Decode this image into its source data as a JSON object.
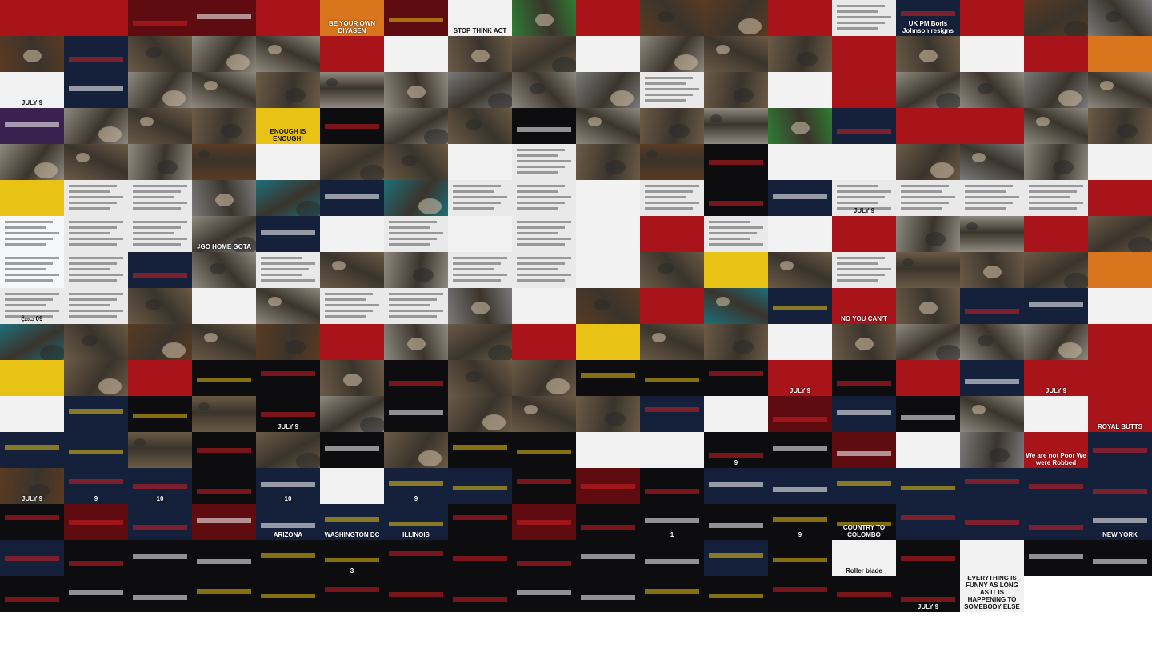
{
  "grid": {
    "cols": 18,
    "rows": 17,
    "tile_count": 302
  },
  "palette": {
    "red": "#a8141a",
    "darkred": "#5e0c10",
    "black": "#0d0d10",
    "navy": "#15203a",
    "white": "#f2f2f2",
    "gray": "#7a7a7a",
    "street": "#8f8a80",
    "crowd": "#6b5a46",
    "yellow": "#e8c316",
    "orange": "#d9751c",
    "green": "#2e7d32",
    "teal": "#1c6f7a",
    "doc": "#e9e9ea",
    "twitter": "#f5f7fa",
    "brown": "#5a3a22",
    "purple": "#3b2150"
  },
  "rows": [
    [
      "red",
      "red",
      "darkred",
      "darkred",
      "red",
      "orange",
      "darkred",
      "white",
      "green",
      "red",
      "brown",
      "brown",
      "red",
      "doc",
      "navy",
      "red",
      "brown",
      "gray"
    ],
    [
      "brown",
      "navy",
      "crowd",
      "street",
      "street",
      "red",
      "white",
      "crowd",
      "crowd",
      "white",
      "street",
      "crowd",
      "crowd",
      "red",
      "crowd",
      "white",
      "red",
      "orange"
    ],
    [
      "white",
      "navy",
      "street",
      "street",
      "crowd",
      "street",
      "street",
      "gray",
      "street",
      "gray",
      "doc",
      "crowd",
      "white",
      "red",
      "street",
      "street",
      "gray",
      "street"
    ],
    [
      "purple",
      "street",
      "crowd",
      "crowd",
      "yellow",
      "black",
      "street",
      "crowd",
      "black",
      "street",
      "crowd",
      "street",
      "green",
      "navy",
      "red",
      "red",
      "street",
      "crowd"
    ],
    [
      "street",
      "crowd",
      "street",
      "brown",
      "white",
      "crowd",
      "crowd",
      "white",
      "doc",
      "crowd",
      "brown",
      "black",
      "white",
      "white",
      "crowd",
      "gray",
      "street",
      "white"
    ],
    [
      "yellow",
      "doc",
      "doc",
      "gray",
      "teal",
      "navy",
      "teal",
      "doc",
      "doc",
      "white",
      "doc",
      "black",
      "navy",
      "doc",
      "doc",
      "doc",
      "doc",
      "red"
    ],
    [
      "twitter",
      "doc",
      "doc",
      "street",
      "navy",
      "white",
      "doc",
      "white",
      "doc",
      "white",
      "red",
      "doc",
      "white",
      "red",
      "street",
      "street",
      "red",
      "crowd"
    ],
    [
      "twitter",
      "doc",
      "navy",
      "street",
      "doc",
      "crowd",
      "street",
      "doc",
      "doc",
      "white",
      "crowd",
      "yellow",
      "crowd",
      "doc",
      "crowd",
      "crowd",
      "crowd",
      "orange"
    ],
    [
      "doc",
      "doc",
      "crowd",
      "white",
      "street",
      "doc",
      "doc",
      "gray",
      "white",
      "brown",
      "red",
      "teal",
      "navy",
      "red",
      "crowd",
      "navy",
      "navy",
      "white"
    ],
    [
      "teal",
      "crowd",
      "brown",
      "crowd",
      "brown",
      "red",
      "street",
      "crowd",
      "red",
      "yellow",
      "crowd",
      "crowd",
      "white",
      "crowd",
      "street",
      "street",
      "street",
      "red"
    ],
    [
      "yellow",
      "crowd",
      "red",
      "black",
      "black",
      "crowd",
      "black",
      "crowd",
      "crowd",
      "black",
      "black",
      "black",
      "red",
      "black",
      "red",
      "navy",
      "red",
      "red"
    ],
    [
      "white",
      "navy",
      "black",
      "crowd",
      "black",
      "street",
      "black",
      "crowd",
      "crowd",
      "crowd",
      "navy",
      "white",
      "darkred",
      "navy",
      "black",
      "street",
      "white",
      "red"
    ],
    [
      "navy",
      "navy",
      "crowd",
      "black",
      "crowd",
      "black",
      "crowd",
      "black",
      "black",
      "white",
      "white",
      "black",
      "black",
      "darkred",
      "white",
      "gray",
      "red",
      "navy"
    ],
    [
      "brown",
      "navy",
      "navy",
      "black",
      "navy",
      "white",
      "navy",
      "navy",
      "black",
      "darkred",
      "black",
      "navy",
      "navy",
      "navy",
      "navy",
      "navy",
      "navy",
      "navy"
    ],
    [
      "black",
      "darkred",
      "navy",
      "darkred",
      "navy",
      "navy",
      "navy",
      "black",
      "darkred",
      "black",
      "black",
      "black",
      "black",
      "black",
      "navy",
      "navy",
      "navy",
      "navy"
    ],
    [
      "navy",
      "black",
      "black",
      "black",
      "black",
      "black",
      "black",
      "black",
      "black",
      "black",
      "black",
      "navy",
      "black",
      "white",
      "black",
      "white",
      "black",
      "black"
    ],
    [
      "black",
      "black",
      "black",
      "black",
      "black",
      "black",
      "black",
      "black",
      "black",
      "black",
      "black",
      "black",
      "black",
      "black",
      "black",
      "white"
    ]
  ],
  "captions": {
    "0.5": "BE YOUR OWN DIYASEN",
    "0.7": "STOP THINK ACT",
    "0.14": "UK PM Boris Johnson resigns",
    "2.0": "JULY 9",
    "3.4": "ENOUGH IS ENOUGH!",
    "5.13": "JULY 9",
    "6.3": "#GO HOME GOTA",
    "8.0": "දිනය 09",
    "8.13": "NO YOU CAN'T",
    "10.12": "JULY 9",
    "10.16": "JULY 9",
    "11.4": "JULY 9",
    "11.17": "ROYAL BUTTS",
    "12.11": "9",
    "12.16": "We are not Poor We were Robbed",
    "13.0": "JULY 9",
    "13.1": "9",
    "13.2": "10",
    "13.4": "10",
    "13.6": "9",
    "14.4": "ARIZONA",
    "14.5": "WASHINGTON DC",
    "14.6": "ILLINOIS",
    "14.10": "1",
    "14.12": "9",
    "14.13": "COUNTRY TO COLOMBO",
    "14.17": "NEW YORK",
    "15.5": "3",
    "15.13": "Roller blade",
    "16.14": "JULY 9",
    "16.15": "EVERYTHING IS FUNNY AS LONG AS IT IS HAPPENING TO SOMEBODY ELSE"
  }
}
